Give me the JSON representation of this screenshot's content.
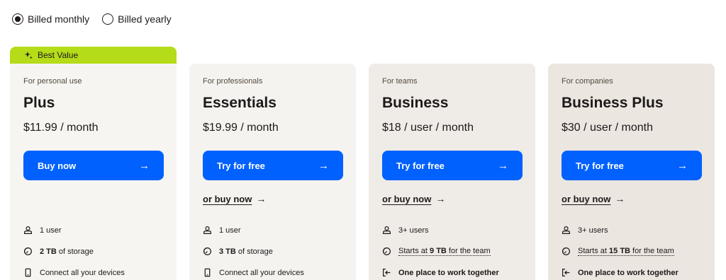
{
  "billing": {
    "monthly_label": "Billed monthly",
    "yearly_label": "Billed yearly",
    "selected": "monthly"
  },
  "badge": {
    "label": "Best Value",
    "color": "#b4dc19"
  },
  "accent_color": "#0061fe",
  "plans": [
    {
      "audience": "For personal use",
      "name": "Plus",
      "price": "$11.99 / month",
      "cta": "Buy now",
      "buy_now": "",
      "features": [
        {
          "icon": "user-icon",
          "text": "1 user"
        },
        {
          "icon": "storage-icon",
          "bold": "2 TB",
          "text": " of storage"
        },
        {
          "icon": "device-icon",
          "text": "Connect all your devices"
        }
      ]
    },
    {
      "audience": "For professionals",
      "name": "Essentials",
      "price": "$19.99 / month",
      "cta": "Try for free",
      "buy_now": "or buy now",
      "features": [
        {
          "icon": "user-icon",
          "text": "1 user"
        },
        {
          "icon": "storage-icon",
          "bold": "3 TB",
          "text": " of storage"
        },
        {
          "icon": "device-icon",
          "text": "Connect all your devices"
        }
      ]
    },
    {
      "audience": "For teams",
      "name": "Business",
      "price": "$18 / user / month",
      "cta": "Try for free",
      "buy_now": "or buy now",
      "features": [
        {
          "icon": "users-icon",
          "text": "3+ users"
        },
        {
          "icon": "storage-icon",
          "pre": "Starts at ",
          "bold": "9 TB",
          "text": " for the team"
        },
        {
          "icon": "workspace-icon",
          "text": "One place to work together"
        }
      ]
    },
    {
      "audience": "For companies",
      "name": "Business Plus",
      "price": "$30 / user / month",
      "cta": "Try for free",
      "buy_now": "or buy now",
      "features": [
        {
          "icon": "users-icon",
          "text": "3+ users"
        },
        {
          "icon": "storage-icon",
          "pre": "Starts at ",
          "bold": "15 TB",
          "text": " for the team"
        },
        {
          "icon": "workspace-icon",
          "text": "One place to work together"
        }
      ]
    }
  ]
}
